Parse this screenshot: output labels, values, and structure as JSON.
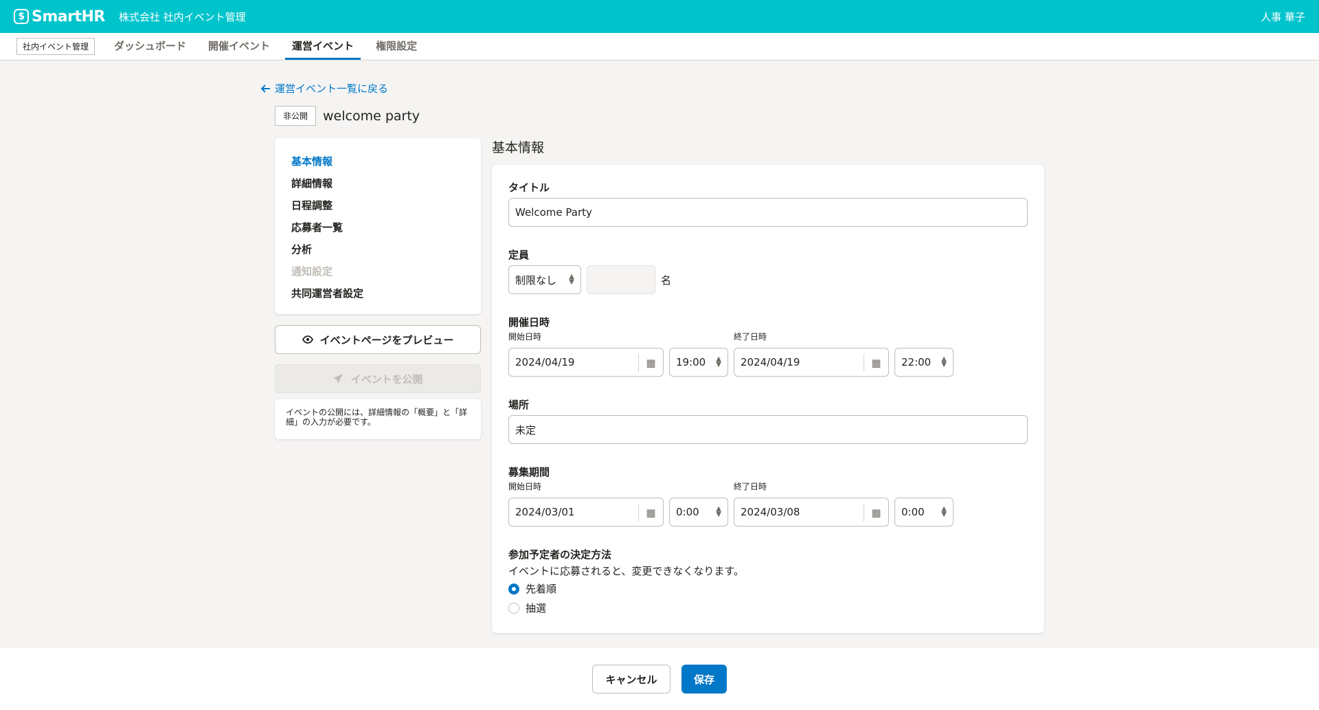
{
  "header": {
    "logo_text": "SmartHR",
    "company": "株式会社 社内イベント管理",
    "user": "人事 華子",
    "brand_color": "#00c4cc"
  },
  "nav": {
    "app_tag": "社内イベント管理",
    "tabs": [
      {
        "label": "ダッシュボード",
        "active": false
      },
      {
        "label": "開催イベント",
        "active": false
      },
      {
        "label": "運営イベント",
        "active": true
      },
      {
        "label": "権限設定",
        "active": false
      }
    ]
  },
  "page": {
    "back_link": "運営イベント一覧に戻る",
    "status_tag": "非公開",
    "event_title": "welcome party"
  },
  "sidebar": {
    "items": [
      {
        "label": "基本情報",
        "state": "active"
      },
      {
        "label": "詳細情報",
        "state": "normal"
      },
      {
        "label": "日程調整",
        "state": "normal"
      },
      {
        "label": "応募者一覧",
        "state": "normal"
      },
      {
        "label": "分析",
        "state": "normal"
      },
      {
        "label": "通知設定",
        "state": "disabled"
      },
      {
        "label": "共同運営者設定",
        "state": "normal"
      }
    ],
    "preview_button": "イベントページをプレビュー",
    "publish_button": "イベントを公開",
    "publish_note": "イベントの公開には、詳細情報の「概要」と「詳細」の入力が必要です。"
  },
  "form": {
    "section_title": "基本情報",
    "title": {
      "label": "タイトル",
      "value": "Welcome Party"
    },
    "capacity": {
      "label": "定員",
      "select_value": "制限なし",
      "number_value": "",
      "unit": "名"
    },
    "event_datetime": {
      "label": "開催日時",
      "start_label": "開始日時",
      "end_label": "終了日時",
      "start_date": "2024/04/19",
      "start_time": "19:00",
      "end_date": "2024/04/19",
      "end_time": "22:00"
    },
    "location": {
      "label": "場所",
      "value": "未定"
    },
    "recruitment": {
      "label": "募集期間",
      "start_label": "開始日時",
      "end_label": "終了日時",
      "start_date": "2024/03/01",
      "start_time": "0:00",
      "end_date": "2024/03/08",
      "end_time": "0:00"
    },
    "selection": {
      "label": "参加予定者の決定方法",
      "description": "イベントに応募されると、変更できなくなります。",
      "options": [
        {
          "label": "先着順",
          "checked": true
        },
        {
          "label": "抽選",
          "checked": false
        }
      ]
    }
  },
  "footer": {
    "cancel": "キャンセル",
    "save": "保存",
    "primary_color": "#0077c7"
  }
}
